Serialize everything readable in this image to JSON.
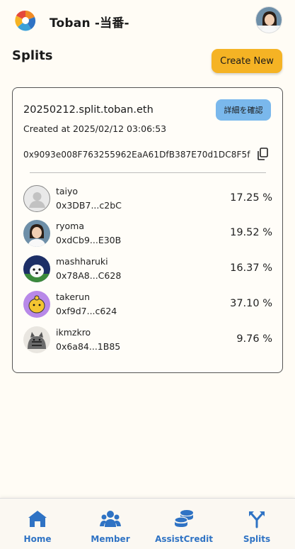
{
  "header": {
    "app_title": "Toban -当番-"
  },
  "page": {
    "title": "Splits",
    "create_button": "Create New"
  },
  "split": {
    "name": "20250212.split.toban.eth",
    "detail_button": "詳細を確認",
    "created_at": "Created at 2025/02/12 03:06:53",
    "address": "0x9093e008F763255962EaA61DfB387E70d1DC8F5f",
    "members": [
      {
        "name": "taiyo",
        "address": "0x3DB7...c2bC",
        "percent": "17.25 %"
      },
      {
        "name": "ryoma",
        "address": "0xdCb9...E30B",
        "percent": "19.52 %"
      },
      {
        "name": "mashharuki",
        "address": "0x78A8...C628",
        "percent": "16.37 %"
      },
      {
        "name": "takerun",
        "address": "0xf9d7...c624",
        "percent": "37.10 %"
      },
      {
        "name": "ikmzkro",
        "address": "0x6a84...1B85",
        "percent": "9.76 %"
      }
    ]
  },
  "nav": {
    "items": [
      {
        "label": "Home",
        "icon": "home-icon"
      },
      {
        "label": "Member",
        "icon": "members-icon"
      },
      {
        "label": "AssistCredit",
        "icon": "coins-icon"
      },
      {
        "label": "Splits",
        "icon": "split-icon"
      }
    ],
    "accent": "#2f73c4"
  },
  "colors": {
    "primary_button": "#f5b324",
    "secondary_button": "#7ab8ec",
    "background": "#fffcf5"
  }
}
